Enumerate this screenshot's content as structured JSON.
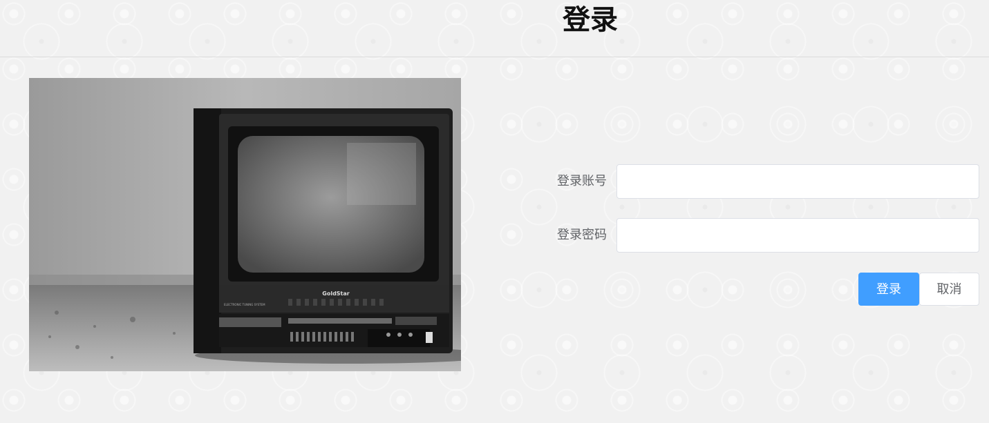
{
  "page": {
    "title": "登录"
  },
  "hero_image": {
    "tv_brand": "GoldStar",
    "tv_panel_text": "ELECTRONIC TUNING SYSTEM"
  },
  "form": {
    "account_label": "登录账号",
    "account_value": "",
    "password_label": "登录密码",
    "password_value": "",
    "login_button": "登录",
    "cancel_button": "取消"
  },
  "colors": {
    "primary": "#409eff",
    "label_text": "#606266",
    "input_border": "#dcdfe6",
    "background": "#f1f1f1"
  }
}
